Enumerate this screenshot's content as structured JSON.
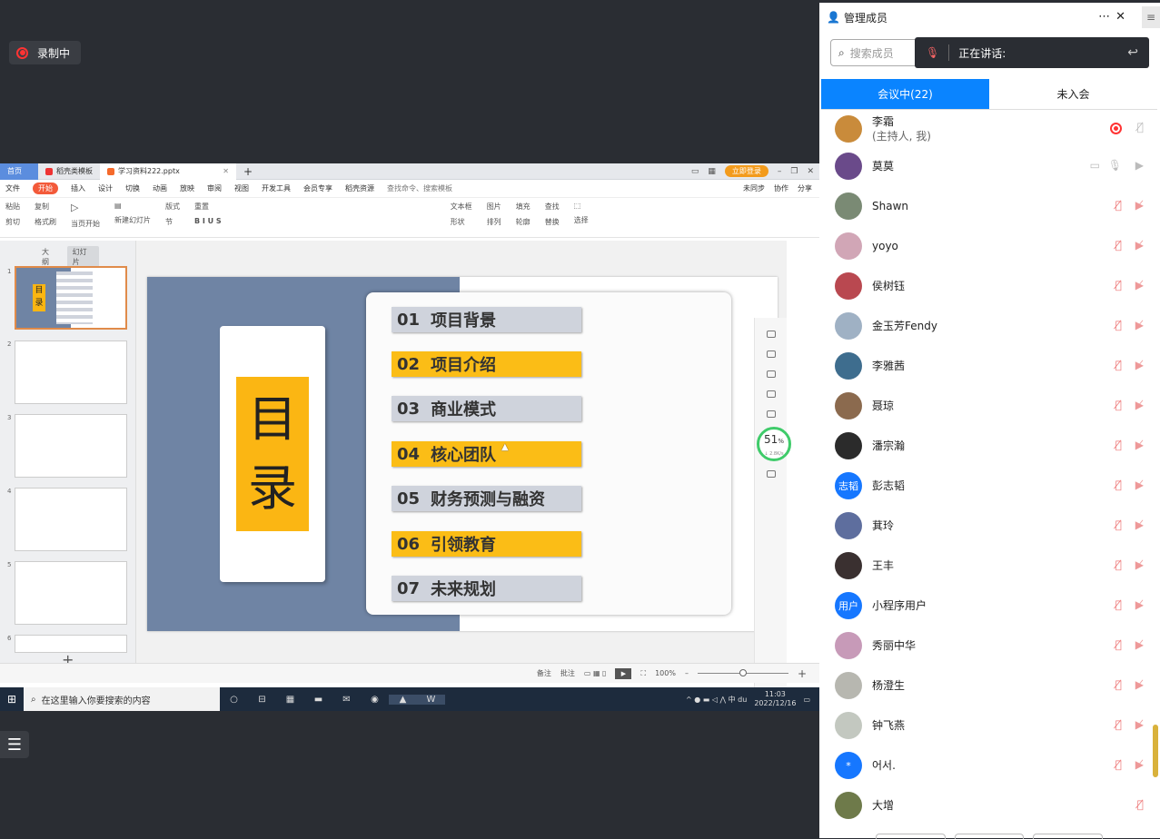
{
  "recording": {
    "label": "录制中"
  },
  "wps": {
    "home_tab": "首页",
    "tabs": [
      "稻壳类模板",
      "学习资料222.pptx"
    ],
    "login": "立即登录",
    "menu": [
      "文件",
      "开始",
      "插入",
      "设计",
      "切换",
      "动画",
      "放映",
      "审阅",
      "视图",
      "开发工具",
      "会员专享",
      "稻壳资源"
    ],
    "search_cmd": "查找命令、搜索模板",
    "menu_right": [
      "未同步",
      "协作",
      "分享"
    ],
    "toolbar": [
      "粘贴",
      "剪切",
      "复制",
      "格式刷",
      "当页开始",
      "新建幻灯片",
      "版式",
      "重置",
      "节",
      "文本框",
      "形状",
      "图片",
      "排列",
      "填充",
      "轮廓",
      "查找",
      "替换",
      "选择"
    ],
    "float_bar": [
      "du",
      "中"
    ],
    "left_tabs": [
      "大纲",
      "幻灯片"
    ],
    "slide_numbers": [
      "1",
      "2",
      "3",
      "4",
      "5",
      "6"
    ],
    "thumb_title": [
      "目",
      "录"
    ],
    "slide": {
      "title": [
        "目",
        "录"
      ],
      "items": [
        {
          "num": "01",
          "text": "项目背景",
          "style": "g"
        },
        {
          "num": "02",
          "text": "项目介绍",
          "style": "y"
        },
        {
          "num": "03",
          "text": "商业模式",
          "style": "g"
        },
        {
          "num": "04",
          "text": "核心团队",
          "style": "y"
        },
        {
          "num": "05",
          "text": "财务预测与融资",
          "style": "g"
        },
        {
          "num": "06",
          "text": "引领教育",
          "style": "y"
        },
        {
          "num": "07",
          "text": "未来规划",
          "style": "g"
        }
      ]
    },
    "gauge": {
      "value": "51",
      "unit": "%",
      "sub": "↓ 2.8K/s"
    },
    "status": {
      "notes": "备注",
      "comment": "批注",
      "zoom": "100%"
    }
  },
  "taskbar": {
    "search": "在这里输入你要搜索的内容",
    "time": "11:03",
    "date": "2022/12/16"
  },
  "panel": {
    "title": "管理成员",
    "search_placeholder": "搜索成员",
    "speaking": "正在讲话:",
    "tabs": {
      "in": "会议中(22)",
      "out": "未入会"
    },
    "members": [
      {
        "name": "李霜",
        "sub": "(主持人, 我)",
        "color": "#c98b3b",
        "txt": ""
      },
      {
        "name": "莫莫",
        "sub": "",
        "color": "#6a4a8a",
        "txt": ""
      },
      {
        "name": "Shawn",
        "sub": "",
        "color": "#7a8a74",
        "txt": ""
      },
      {
        "name": "yoyo",
        "sub": "",
        "color": "#d1a6b6",
        "txt": ""
      },
      {
        "name": "侯树钰",
        "sub": "",
        "color": "#b94850",
        "txt": ""
      },
      {
        "name": "金玉芳Fendy",
        "sub": "",
        "color": "#9fb1c4",
        "txt": ""
      },
      {
        "name": "李雅茜",
        "sub": "",
        "color": "#3e6d8e",
        "txt": ""
      },
      {
        "name": "聂琼",
        "sub": "",
        "color": "#8b6a4e",
        "txt": ""
      },
      {
        "name": "潘宗瀚",
        "sub": "",
        "color": "#2b2b2b",
        "txt": ""
      },
      {
        "name": "彭志韬",
        "sub": "",
        "color": "#1677ff",
        "txt": "志韬"
      },
      {
        "name": "萁玲",
        "sub": "",
        "color": "#5e6e9e",
        "txt": ""
      },
      {
        "name": "王丰",
        "sub": "",
        "color": "#3a3030",
        "txt": ""
      },
      {
        "name": "小程序用户",
        "sub": "",
        "color": "#1677ff",
        "txt": "用户"
      },
      {
        "name": "秀丽中华",
        "sub": "",
        "color": "#c79ab8",
        "txt": ""
      },
      {
        "name": "杨澄生",
        "sub": "",
        "color": "#b7b7b0",
        "txt": ""
      },
      {
        "name": "钟飞燕",
        "sub": "",
        "color": "#c3c8c0",
        "txt": ""
      },
      {
        "name": "어서.",
        "sub": "",
        "color": "#1677ff",
        "txt": "*"
      },
      {
        "name": "大增",
        "sub": "",
        "color": "#6e7a4a",
        "txt": ""
      }
    ]
  }
}
